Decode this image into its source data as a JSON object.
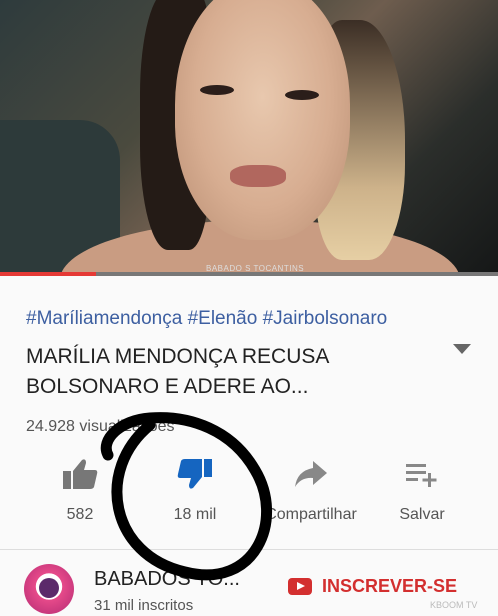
{
  "video": {
    "watermark": "BABADO S TOCANTINS"
  },
  "hashtags": "#Maríliamendonça #Elenão #Jairbolsonaro",
  "title": "MARÍLIA MENDONÇA RECUSA BOLSONARO E ADERE AO...",
  "views": "24.928 visualizações",
  "actions": {
    "like_count": "582",
    "dislike_count": "18 mil",
    "share_label": "Compartilhar",
    "save_label": "Salvar"
  },
  "channel": {
    "name": "BABADOS TO...",
    "subscribers": "31 mil inscritos",
    "subscribe_label": "INSCREVER-SE"
  },
  "source_mark": "KBOOM TV",
  "colors": {
    "hashtag": "#3d5fa1",
    "dislike_active": "#1565c0",
    "subscribe": "#d32f2f",
    "progress": "#e53935"
  }
}
